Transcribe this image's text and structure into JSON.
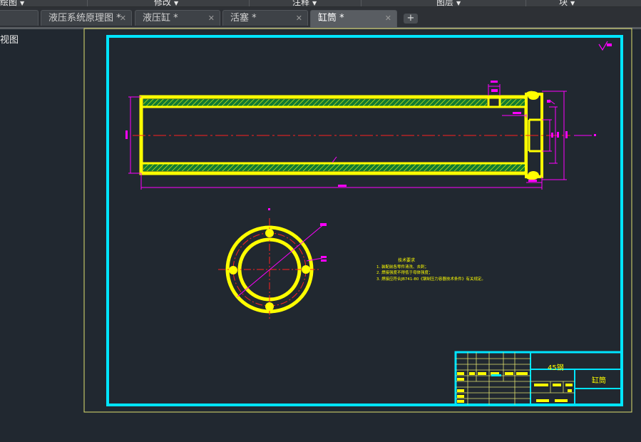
{
  "ribbon": {
    "groups": [
      {
        "label": "绘图"
      },
      {
        "label": "修改"
      },
      {
        "label": "注释"
      },
      {
        "label": "图层"
      },
      {
        "label": "块"
      }
    ]
  },
  "tabs": [
    {
      "label": ""
    },
    {
      "label": "液压系统原理图 *"
    },
    {
      "label": "液压缸 *"
    },
    {
      "label": "活塞 *"
    },
    {
      "label": "缸筒 *"
    }
  ],
  "tab_close_glyph": "✕",
  "new_tab_glyph": "+",
  "side_label": "俯视图",
  "drawing": {
    "notes_title": "技术要求",
    "notes": [
      "1. 装配前各零件清洗、去刺；",
      "2. 焊接强度不得低于母体强度；",
      "3. 焊接应符合JB741-80《钢制压力容器技术条件》有关规定。"
    ],
    "title_block": {
      "material": "45钢",
      "part_name": "缸筒"
    },
    "colors": {
      "frame": "#00e5ff",
      "part": "#ffff00",
      "dimension": "#ff00ff",
      "centerline": "#ff2020",
      "hatch": "#0f7a33",
      "text": "#ffff00",
      "background": "#212830"
    }
  }
}
